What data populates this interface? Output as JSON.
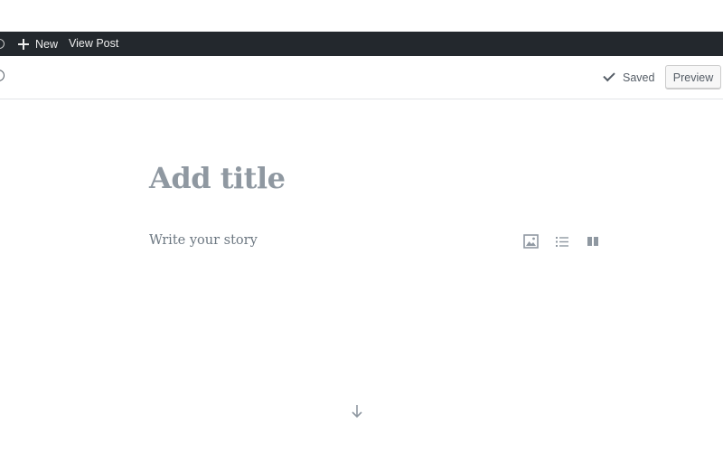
{
  "admin_bar": {
    "new_label": "New",
    "view_post_label": "View Post",
    "background": "#23282d"
  },
  "header": {
    "saved_label": "Saved",
    "preview_label": "Preview"
  },
  "editor": {
    "title_placeholder": "Add title",
    "body_placeholder": "Write your story",
    "inserter_icons": [
      "image-icon",
      "list-icon",
      "columns-icon"
    ]
  },
  "footer": {
    "scroll_icon": "arrow-down-icon"
  }
}
